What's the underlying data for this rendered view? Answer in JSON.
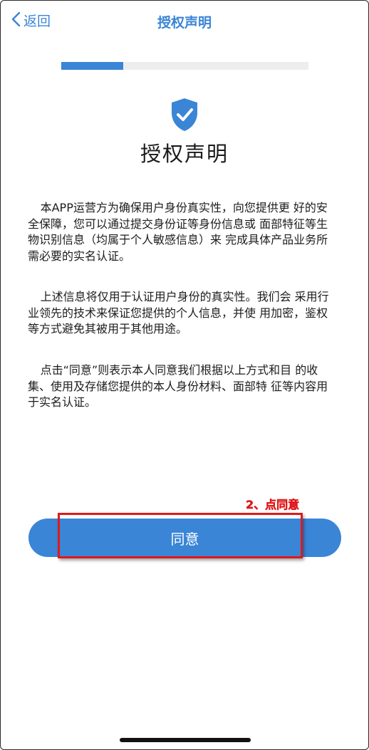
{
  "nav": {
    "back_label": "返回",
    "title": "授权声明"
  },
  "progress": {
    "fraction": 0.25,
    "color": "#3a85d6"
  },
  "icons": {
    "back": "chevron-left-icon",
    "shield": "shield-check-icon"
  },
  "main": {
    "heading": "授权声明",
    "paragraphs": [
      "本APP运营方为确保用户身份真实性，向您提供更 好的安全保障，您可以通过提交身份证等身份信息或 面部特征等生物识别信息（均属于个人敏感信息）来 完成具体产品业务所需必要的实名认证。",
      "上述信息将仅用于认证用户身份的真实性。我们会 采用行业领先的技术来保证您提供的个人信息，并使 用加密，鉴权等方式避免其被用于其他用途。",
      "点击“同意”则表示本人同意我们根据以上方式和目 的收集、使用及存储您提供的本人身份材料、面部特 征等内容用于实名认证。"
    ],
    "agree_label": "同意"
  },
  "annotation": {
    "text": "2、点同意",
    "color": "#e0191b"
  },
  "colors": {
    "accent": "#3a85d6",
    "annotation_red": "#e0191b"
  }
}
